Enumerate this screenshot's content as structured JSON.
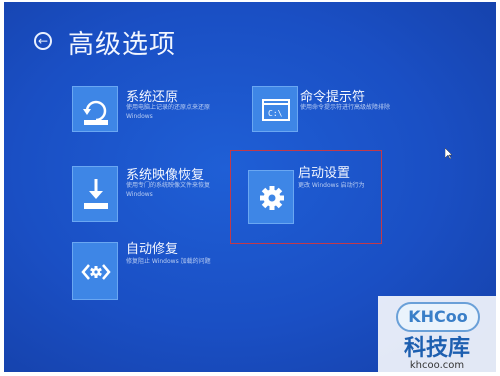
{
  "page_title": "高级选项",
  "options": [
    {
      "title": "系统还原",
      "desc_line1": "使用电脑上记录的还原点来还原",
      "desc_line2": "Windows",
      "icon": "system-restore-icon"
    },
    {
      "title": "命令提示符",
      "desc_line1": "使用命令提示符进行高级故障排除",
      "desc_line2": "",
      "icon": "command-prompt-icon"
    },
    {
      "title": "系统映像恢复",
      "desc_line1": "使用专门的系统映像文件来恢复",
      "desc_line2": "Windows",
      "icon": "system-image-recovery-icon"
    },
    {
      "title": "启动设置",
      "desc_line1": "更改 Windows 启动行为",
      "desc_line2": "",
      "icon": "gear-icon"
    },
    {
      "title": "自动修复",
      "desc_line1": "修复阻止 Windows 加载的问题",
      "desc_line2": "",
      "icon": "automatic-repair-icon"
    }
  ],
  "watermark": {
    "logo": "KHCoo",
    "name": "科技库",
    "url": "khcoo.com"
  },
  "colors": {
    "background": "#1a4fc4",
    "tile": "#3e86e6",
    "highlight": "#c23a4a"
  }
}
